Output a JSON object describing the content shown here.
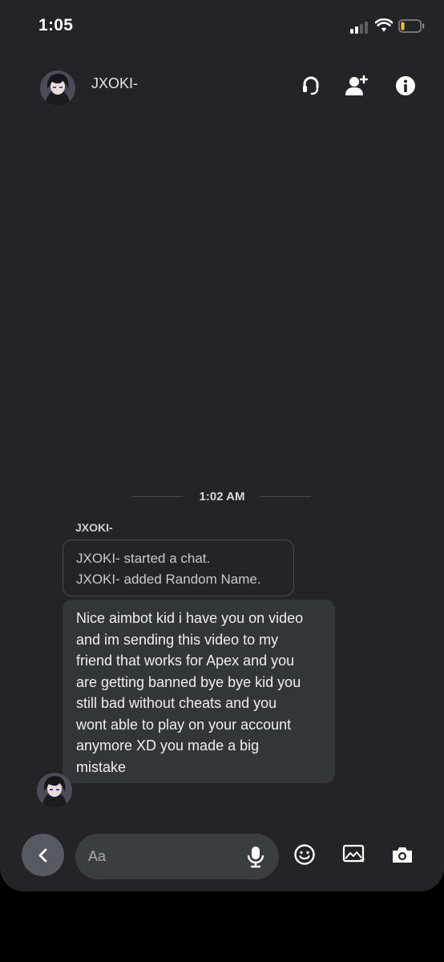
{
  "status_bar": {
    "time": "1:05"
  },
  "header": {
    "contact_name": "JXOKI-"
  },
  "chat": {
    "timestamp": "1:02 AM",
    "sender_name": "JXOKI-",
    "system_lines": [
      "JXOKI- started a chat.",
      "JXOKI- added Random Name."
    ],
    "message_lines": [
      "Nice aimbot kid i have you on video",
      "and im sending this video to my",
      "friend that works for Apex and you",
      "are getting banned bye bye kid you",
      "still bad without cheats and you",
      "wont able to play on your account",
      "anymore XD you made a big",
      "mistake"
    ]
  },
  "composer": {
    "placeholder": "Aa"
  },
  "icons": {
    "header": [
      "headset-icon",
      "add-friend-icon",
      "info-icon"
    ],
    "composer": [
      "back-icon",
      "mic-icon",
      "emoji-icon",
      "image-icon",
      "camera-icon"
    ]
  },
  "colors": {
    "background": "#222427",
    "bubble": "#32353a",
    "battery_low": "#f2c23a"
  }
}
